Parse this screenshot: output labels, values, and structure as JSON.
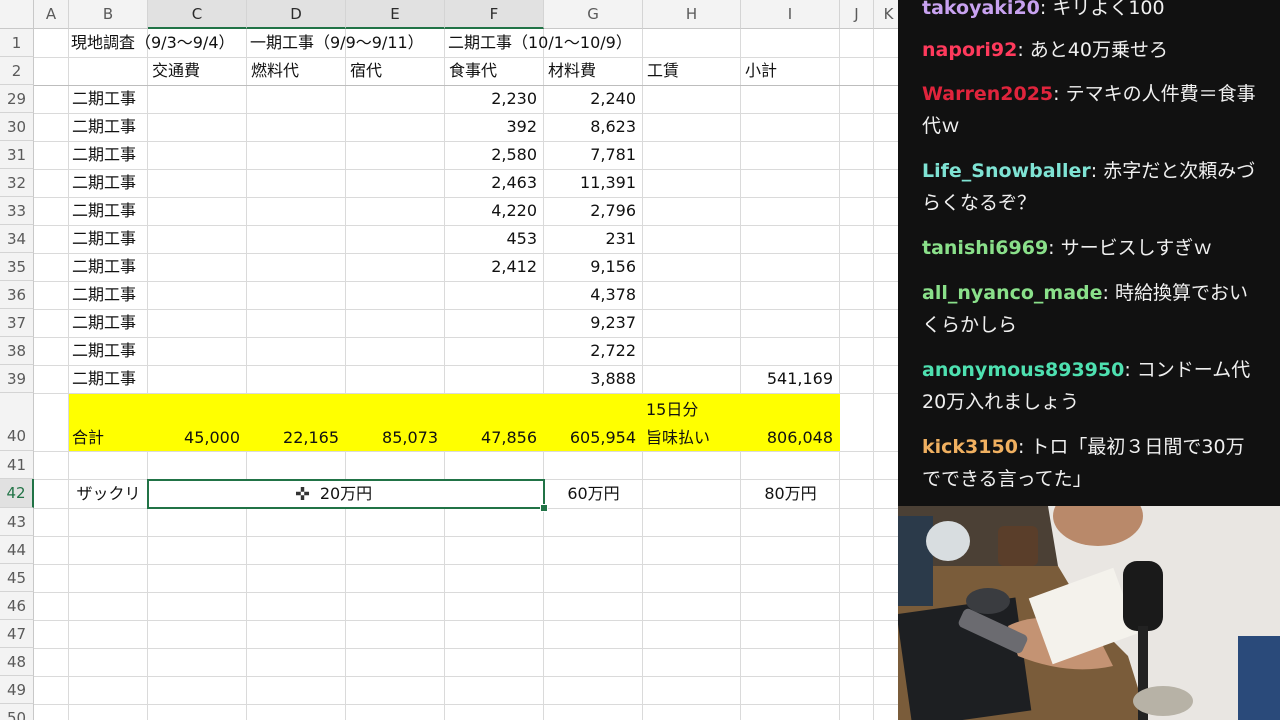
{
  "sheet": {
    "columns": [
      "A",
      "B",
      "C",
      "D",
      "E",
      "F",
      "G",
      "H",
      "I",
      "J",
      "K"
    ],
    "header_row1": {
      "b": "現地調査（9/3〜9/4）",
      "d": "一期工事（9/9〜9/11）",
      "f": "二期工事（10/1〜10/9）"
    },
    "header_row2": {
      "c": "交通費",
      "d": "燃料代",
      "e": "宿代",
      "f": "食事代",
      "g": "材料費",
      "h": "工賃",
      "i": "小計"
    },
    "rows": [
      {
        "num": "29",
        "b": "二期工事",
        "f": "2,230",
        "g": "2,240",
        "i": ""
      },
      {
        "num": "30",
        "b": "二期工事",
        "f": "392",
        "g": "8,623",
        "i": ""
      },
      {
        "num": "31",
        "b": "二期工事",
        "f": "2,580",
        "g": "7,781",
        "i": ""
      },
      {
        "num": "32",
        "b": "二期工事",
        "f": "2,463",
        "g": "11,391",
        "i": ""
      },
      {
        "num": "33",
        "b": "二期工事",
        "f": "4,220",
        "g": "2,796",
        "i": ""
      },
      {
        "num": "34",
        "b": "二期工事",
        "f": "453",
        "g": "231",
        "i": ""
      },
      {
        "num": "35",
        "b": "二期工事",
        "f": "2,412",
        "g": "9,156",
        "i": ""
      },
      {
        "num": "36",
        "b": "二期工事",
        "f": "",
        "g": "4,378",
        "i": ""
      },
      {
        "num": "37",
        "b": "二期工事",
        "f": "",
        "g": "9,237",
        "i": ""
      },
      {
        "num": "38",
        "b": "二期工事",
        "f": "",
        "g": "2,722",
        "i": ""
      },
      {
        "num": "39",
        "b": "二期工事",
        "f": "",
        "g": "3,888",
        "i": "541,169"
      }
    ],
    "total": {
      "num": "40",
      "label": "合計",
      "c": "45,000",
      "d": "22,165",
      "e": "85,073",
      "f": "47,856",
      "g": "605,954",
      "h_line1": "15日分",
      "h_line2": "旨味払い",
      "i": "806,048"
    },
    "rough": {
      "num": "42",
      "label": "ザックリ",
      "merged_value": "20万円",
      "g": "60万円",
      "i": "80万円"
    },
    "empty_rows": [
      "41",
      "43",
      "44",
      "45",
      "46",
      "47",
      "48",
      "49",
      "50"
    ],
    "highlight_color": "#ffff00",
    "selection_color": "#217346"
  },
  "chat": {
    "messages": [
      {
        "user": "takoyaki20",
        "text": "キリよく100",
        "color": "#c8a2f0"
      },
      {
        "user": "napori92",
        "text": "あと40万乗せろ",
        "color": "#ff3a5c"
      },
      {
        "user": "Warren2025",
        "text": "テマキの人件費＝食事代ｗ",
        "color": "#e0243c"
      },
      {
        "user": "Life_Snowballer",
        "text": "赤字だと次頼みづらくなるぞ？",
        "color": "#7fe3d4"
      },
      {
        "user": "tanishi6969",
        "text": "サービスしすぎｗ",
        "color": "#8ae08a"
      },
      {
        "user": "all_nyanco_made",
        "text": "時給換算でおいくらかしら",
        "color": "#8ae08a"
      },
      {
        "user": "anonymous893950",
        "text": "コンドーム代20万入れましょう",
        "color": "#4ee0b0"
      },
      {
        "user": "kick3150",
        "text": "トロ「最初３日間で30万でできる言ってた」",
        "color": "#f0b060"
      }
    ]
  }
}
